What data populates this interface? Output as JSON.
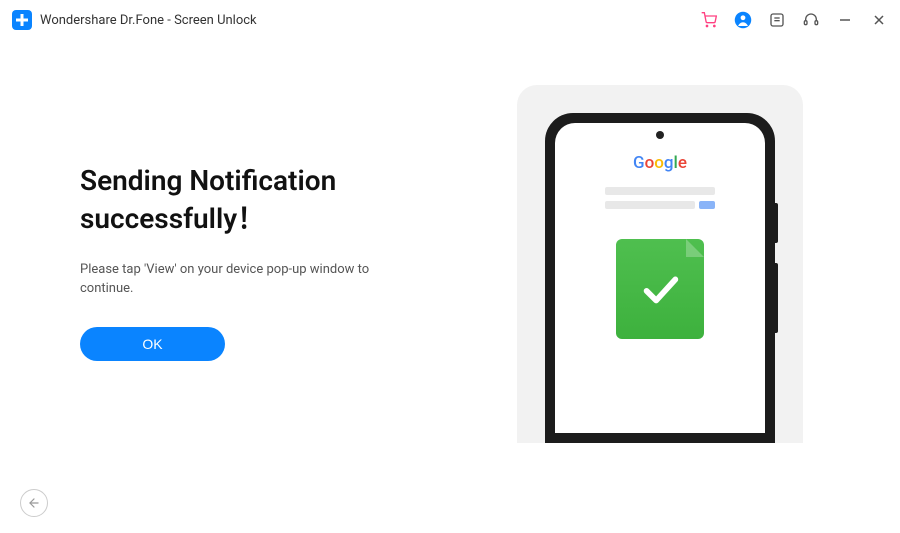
{
  "titlebar": {
    "app_title": "Wondershare Dr.Fone - Screen Unlock"
  },
  "main": {
    "heading": "Sending Notification successfully！",
    "subtext": "Please tap 'View' on your device pop-up window to continue.",
    "ok_label": "OK"
  },
  "illustration": {
    "brand": "Google"
  }
}
